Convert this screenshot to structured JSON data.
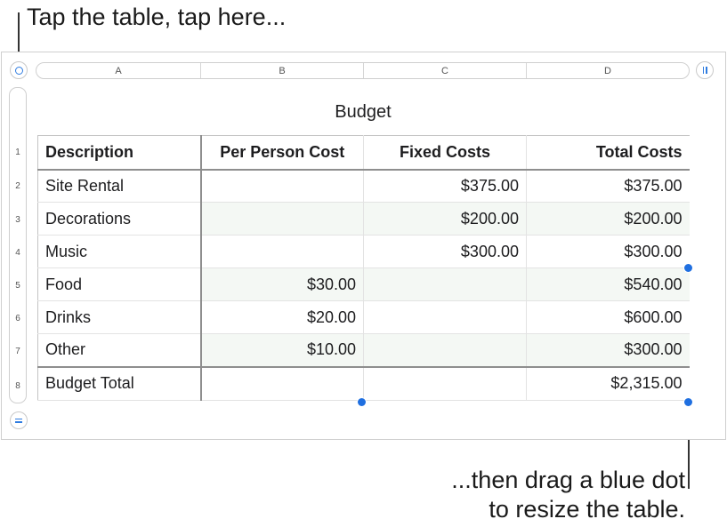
{
  "callouts": {
    "top": "Tap the table, tap here...",
    "bottom_line1": "...then drag a blue dot",
    "bottom_line2": "to resize the table."
  },
  "colors": {
    "accent": "#1f6fe0",
    "row_shade": "#f4f8f4"
  },
  "icons": {
    "table_select": "circle-icon",
    "columns_handle": "vertical-bars-icon",
    "rows_handle": "equals-icon"
  },
  "column_labels": [
    "A",
    "B",
    "C",
    "D"
  ],
  "row_labels": [
    "1",
    "2",
    "3",
    "4",
    "5",
    "6",
    "7",
    "8"
  ],
  "table": {
    "title": "Budget",
    "headers": [
      "Description",
      "Per Person Cost",
      "Fixed Costs",
      "Total Costs"
    ],
    "rows": [
      [
        "Site Rental",
        "",
        "$375.00",
        "$375.00"
      ],
      [
        "Decorations",
        "",
        "$200.00",
        "$200.00"
      ],
      [
        "Music",
        "",
        "$300.00",
        "$300.00"
      ],
      [
        "Food",
        "$30.00",
        "",
        "$540.00"
      ],
      [
        "Drinks",
        "$20.00",
        "",
        "$600.00"
      ],
      [
        "Other",
        "$10.00",
        "",
        "$300.00"
      ]
    ],
    "footer": [
      "Budget Total",
      "",
      "",
      "$2,315.00"
    ]
  }
}
